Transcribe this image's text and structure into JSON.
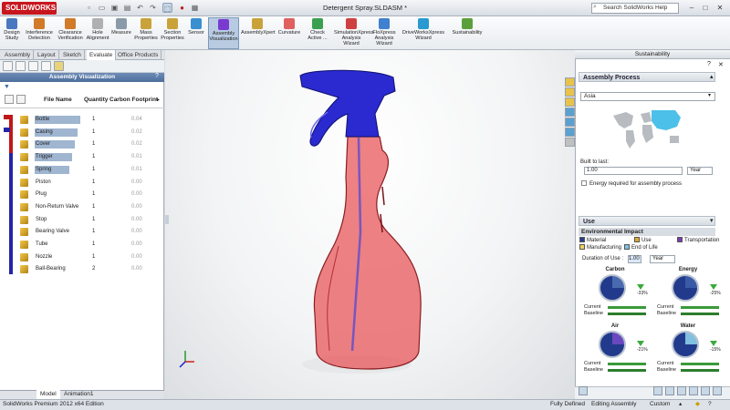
{
  "app": {
    "logo": "SOLIDWORKS",
    "doc_title": "Detergent Spray.SLDASM *"
  },
  "search": {
    "placeholder": "Search SolidWorks Help"
  },
  "window_controls": [
    "–",
    "□",
    "✕"
  ],
  "command_manager": [
    {
      "label": "Design Study",
      "icon": "design-study-icon",
      "color": "#4a78c0"
    },
    {
      "label": "Interference Detection",
      "icon": "interference-icon",
      "color": "#d07a2a"
    },
    {
      "label": "Clearance Verification",
      "icon": "clearance-icon",
      "color": "#d07a2a"
    },
    {
      "label": "Hole Alignment",
      "icon": "hole-alignment-icon",
      "color": "#b0b0b0"
    },
    {
      "label": "Measure",
      "icon": "measure-icon",
      "color": "#8a9aa8"
    },
    {
      "label": "Mass Properties",
      "icon": "mass-properties-icon",
      "color": "#c9a33a"
    },
    {
      "label": "Section Properties",
      "icon": "section-properties-icon",
      "color": "#c9a33a"
    },
    {
      "label": "Sensor",
      "icon": "sensor-icon",
      "color": "#3a8fd0"
    },
    {
      "label": "Assembly Visualization",
      "icon": "assembly-visualization-icon",
      "color": "#7a3ad0"
    },
    {
      "label": "AssemblyXpert",
      "icon": "assemblyxpert-icon",
      "color": "#c9a33a"
    },
    {
      "label": "Curvature",
      "icon": "curvature-icon",
      "color": "#e06060"
    },
    {
      "label": "Check Active ...",
      "icon": "check-active-icon",
      "color": "#3aa050"
    },
    {
      "label": "SimulationXpress Analysis Wizard",
      "icon": "simulationxpress-icon",
      "color": "#d04040"
    },
    {
      "label": "FloXpress Analysis Wizard",
      "icon": "floxpress-icon",
      "color": "#4080d0"
    },
    {
      "label": "DriveWorksXpress Wizard",
      "icon": "driveworksxpress-icon",
      "color": "#2a9ad0"
    },
    {
      "label": "Sustainability",
      "icon": "sustainability-icon",
      "color": "#5aa03a"
    }
  ],
  "cm_tabs": [
    "Assembly",
    "Layout",
    "Sketch",
    "Evaluate",
    "Office Products"
  ],
  "left_panel": {
    "header": "Assembly Visualization",
    "columns": [
      "File Name",
      "Quantity",
      "Carbon Footprint"
    ],
    "rows": [
      {
        "name": "Bottle",
        "qty": "1",
        "cf": "0.04"
      },
      {
        "name": "Casing",
        "qty": "1",
        "cf": "0.02"
      },
      {
        "name": "Cover",
        "qty": "1",
        "cf": "0.02"
      },
      {
        "name": "Trigger",
        "qty": "1",
        "cf": "0.01"
      },
      {
        "name": "Spring",
        "qty": "1",
        "cf": "0.01"
      },
      {
        "name": "Piston",
        "qty": "1",
        "cf": "0.00"
      },
      {
        "name": "Plug",
        "qty": "1",
        "cf": "0.00"
      },
      {
        "name": "Non-Return Valve",
        "qty": "1",
        "cf": "0.00"
      },
      {
        "name": "Stop",
        "qty": "1",
        "cf": "0.00"
      },
      {
        "name": "Bearing Valve",
        "qty": "1",
        "cf": "0.00"
      },
      {
        "name": "Tube",
        "qty": "1",
        "cf": "0.00"
      },
      {
        "name": "Nozzle",
        "qty": "1",
        "cf": "0.00"
      },
      {
        "name": "Ball-Bearing",
        "qty": "2",
        "cf": "0.00"
      }
    ]
  },
  "bottom_tabs": [
    "Model",
    "Animation1"
  ],
  "status": {
    "edition": "SolidWorks Premium 2012 x64 Edition",
    "state": "Fully Defined",
    "mode": "Editing Assembly",
    "units": "Custom"
  },
  "right_panel": {
    "title": "Sustainability",
    "assembly_process": "Assembly Process",
    "region": "Asia",
    "built_to_last_label": "Built to last:",
    "built_to_last_value": "1.00",
    "built_to_last_unit": "Year",
    "energy_label": "Energy required for assembly process",
    "use_label": "Use",
    "env_impact_label": "Environmental Impact",
    "legend": [
      {
        "label": "Material",
        "color": "#2a3f8c"
      },
      {
        "label": "Use",
        "color": "#e0a830"
      },
      {
        "label": "Transportation",
        "color": "#7a3ab0"
      },
      {
        "label": "Manufacturing",
        "color": "#f0d060"
      },
      {
        "label": "End of Life",
        "color": "#80c0e0"
      }
    ],
    "duration_label": "Duration of Use :",
    "duration_value": "1.00",
    "duration_unit": "Year",
    "impacts": [
      {
        "title": "Carbon",
        "pct": "-33%",
        "current": "Current",
        "baseline": "Baseline"
      },
      {
        "title": "Energy",
        "pct": "-25%",
        "current": "Current",
        "baseline": "Baseline"
      },
      {
        "title": "Air",
        "pct": "-21%",
        "current": "Current",
        "baseline": "Baseline"
      },
      {
        "title": "Water",
        "pct": "-15%",
        "current": "Current",
        "baseline": "Baseline"
      }
    ]
  }
}
